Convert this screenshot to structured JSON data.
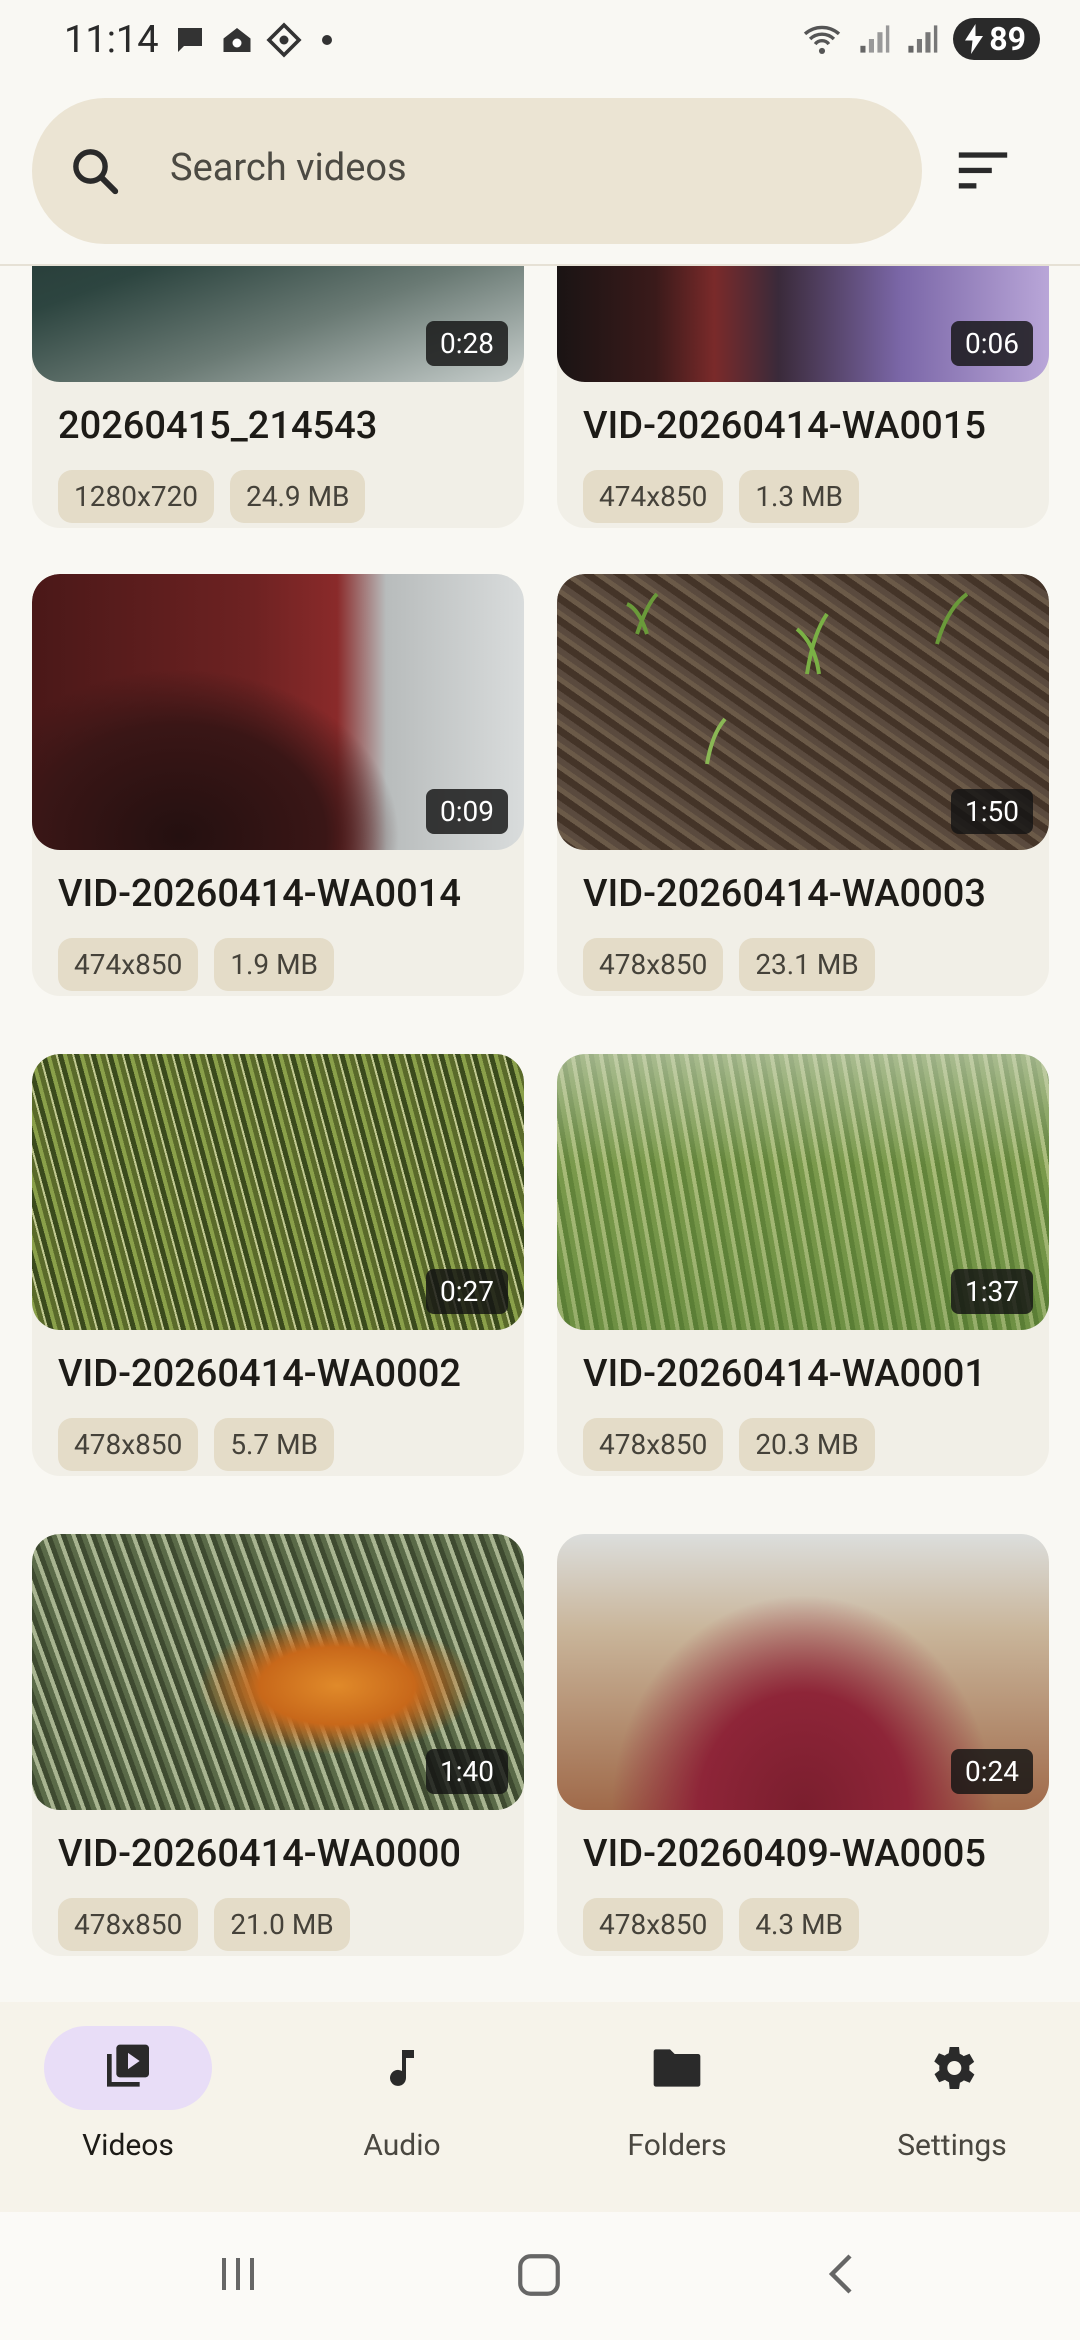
{
  "status_bar": {
    "time": "11:14",
    "battery": "89"
  },
  "search": {
    "placeholder": "Search videos"
  },
  "videos": [
    {
      "name": "20260415_214543",
      "resolution": "1280x720",
      "size": "24.9 MB",
      "duration": "0:28"
    },
    {
      "name": "VID-20260414-WA0015",
      "resolution": "474x850",
      "size": "1.3 MB",
      "duration": "0:06"
    },
    {
      "name": "VID-20260414-WA0014",
      "resolution": "474x850",
      "size": "1.9 MB",
      "duration": "0:09"
    },
    {
      "name": "VID-20260414-WA0003",
      "resolution": "478x850",
      "size": "23.1 MB",
      "duration": "1:50"
    },
    {
      "name": "VID-20260414-WA0002",
      "resolution": "478x850",
      "size": "5.7 MB",
      "duration": "0:27"
    },
    {
      "name": "VID-20260414-WA0001",
      "resolution": "478x850",
      "size": "20.3 MB",
      "duration": "1:37"
    },
    {
      "name": "VID-20260414-WA0000",
      "resolution": "478x850",
      "size": "21.0 MB",
      "duration": "1:40"
    },
    {
      "name": "VID-20260409-WA0005",
      "resolution": "478x850",
      "size": "4.3 MB",
      "duration": "0:24"
    }
  ],
  "bottom_nav": {
    "items": [
      {
        "label": "Videos",
        "icon": "video-library-icon",
        "active": true
      },
      {
        "label": "Audio",
        "icon": "music-note-icon",
        "active": false
      },
      {
        "label": "Folders",
        "icon": "folder-icon",
        "active": false
      },
      {
        "label": "Settings",
        "icon": "gear-icon",
        "active": false
      }
    ]
  },
  "colors": {
    "accent_pill": "#e8ddf7",
    "search_bg": "#ebe4d3",
    "chip_bg": "#e4dcc8"
  }
}
